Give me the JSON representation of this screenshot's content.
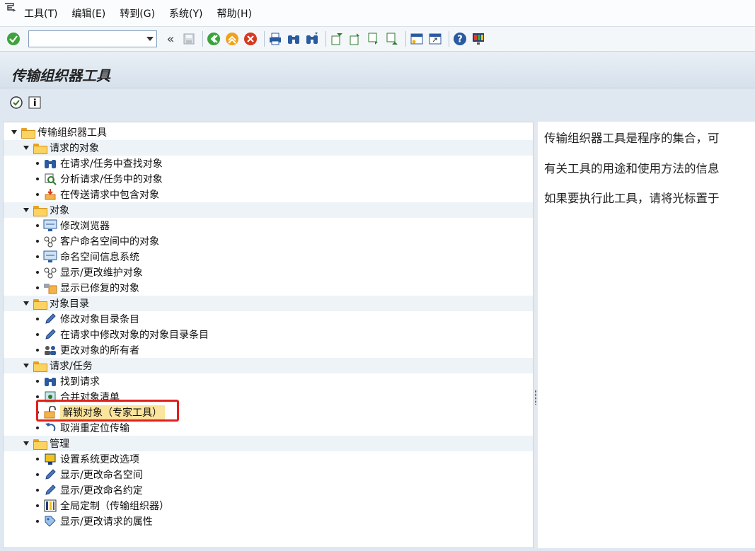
{
  "menubar": {
    "items": [
      "工具(T)",
      "编辑(E)",
      "转到(G)",
      "系统(Y)",
      "帮助(H)"
    ]
  },
  "toolbar": {
    "command_value": "",
    "back_glyph": "«"
  },
  "title": "传输组织器工具",
  "tree": {
    "root": "传输组织器工具",
    "groups": [
      {
        "label": "请求的对象",
        "items": [
          {
            "label": "在请求/任务中查找对象",
            "icon": "binoculars-icon"
          },
          {
            "label": "分析请求/任务中的对象",
            "icon": "analyze-icon"
          },
          {
            "label": "在传送请求中包含对象",
            "icon": "include-object-icon"
          }
        ]
      },
      {
        "label": "对象",
        "items": [
          {
            "label": "修改浏览器",
            "icon": "monitor-icon"
          },
          {
            "label": "客户命名空间中的对象",
            "icon": "hierarchy-icon"
          },
          {
            "label": "命名空间信息系统",
            "icon": "monitor-icon"
          },
          {
            "label": "显示/更改维护对象",
            "icon": "hierarchy-icon"
          },
          {
            "label": "显示已修复的对象",
            "icon": "repair-icon"
          }
        ]
      },
      {
        "label": "对象目录",
        "items": [
          {
            "label": "修改对象目录条目",
            "icon": "pencil-icon"
          },
          {
            "label": "在请求中修改对象的对象目录条目",
            "icon": "pencil-icon"
          },
          {
            "label": "更改对象的所有者",
            "icon": "users-icon"
          }
        ]
      },
      {
        "label": "请求/任务",
        "items": [
          {
            "label": "找到请求",
            "icon": "binoculars-icon"
          },
          {
            "label": "合并对象清单",
            "icon": "merge-icon"
          },
          {
            "label": "解锁对象（专家工具）",
            "icon": "unlock-icon",
            "selected": true
          },
          {
            "label": "取消重定位传输",
            "icon": "undo-icon"
          }
        ]
      },
      {
        "label": "管理",
        "items": [
          {
            "label": "设置系统更改选项",
            "icon": "settings-icon"
          },
          {
            "label": "显示/更改命名空间",
            "icon": "pencil-icon"
          },
          {
            "label": "显示/更改命名约定",
            "icon": "pencil-icon"
          },
          {
            "label": "全局定制（传输组织器）",
            "icon": "table-icon"
          },
          {
            "label": "显示/更改请求的属性",
            "icon": "tag-icon"
          }
        ]
      }
    ]
  },
  "description": [
    "传输组织器工具是程序的集合，可",
    "有关工具的用途和使用方法的信息",
    "如果要执行此工具，请将光标置于"
  ],
  "colors": {
    "selection": "#fbe49b",
    "highlight_border": "#e0211a",
    "folder": "#fcd260"
  }
}
